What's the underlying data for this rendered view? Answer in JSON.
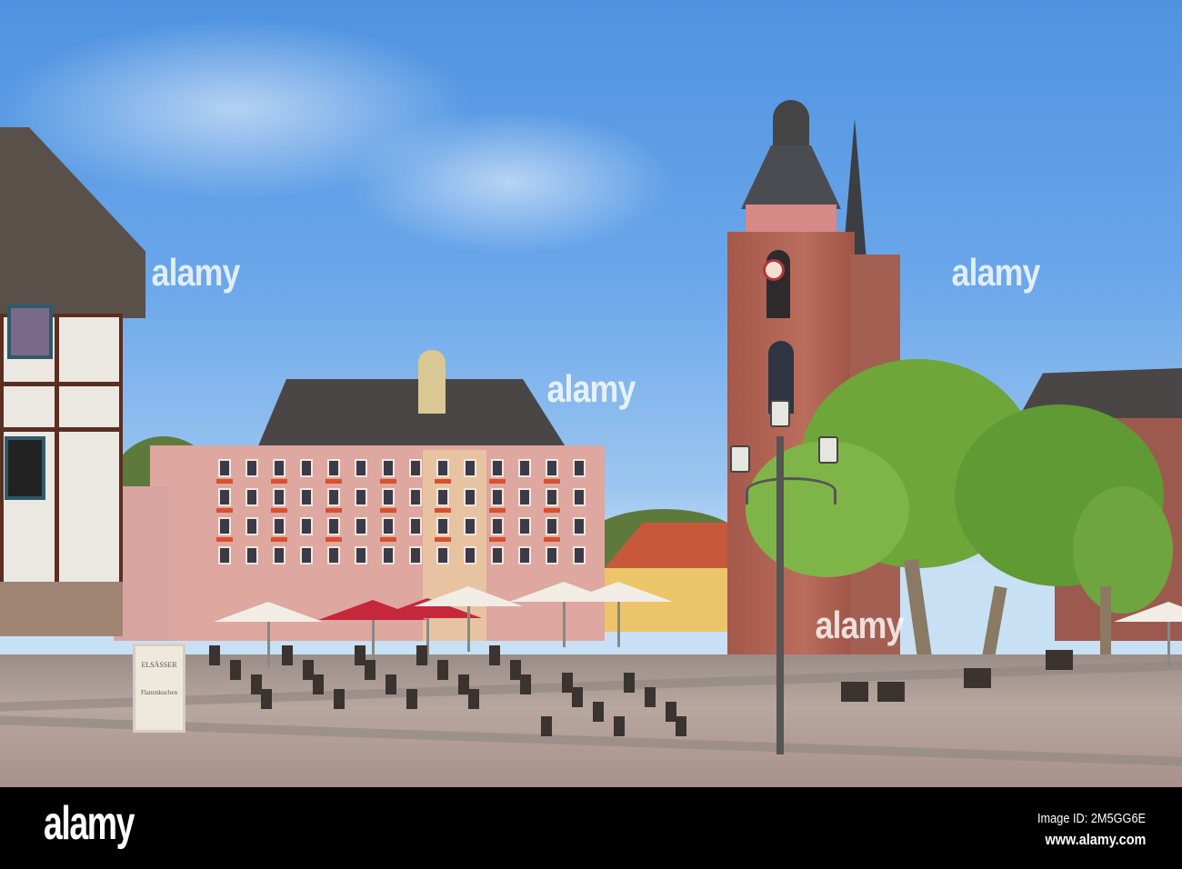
{
  "watermark": "alamy",
  "sign": {
    "title": "ELSÄSSER",
    "subtitle": "Flammkuchen"
  },
  "footer": {
    "logo": "alamy",
    "image_id": "Image ID: 2M5GG6E",
    "url": "www.alamy.com"
  }
}
